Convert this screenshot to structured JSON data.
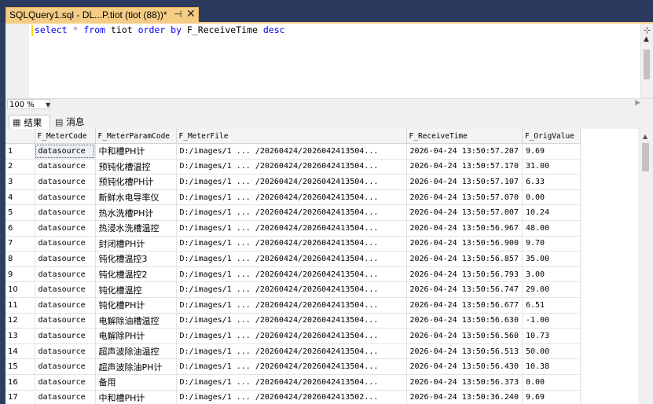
{
  "document_tab": {
    "title": "SQLQuery1.sql - DL...P.tiot (tiot (88))*"
  },
  "editor": {
    "query_tokens": [
      {
        "text": "select",
        "kind": "kw"
      },
      {
        "text": " ",
        "kind": "tx"
      },
      {
        "text": "*",
        "kind": "op"
      },
      {
        "text": " ",
        "kind": "tx"
      },
      {
        "text": "from",
        "kind": "kw"
      },
      {
        "text": " tiot ",
        "kind": "tx"
      },
      {
        "text": "order by",
        "kind": "kw"
      },
      {
        "text": " F_ReceiveTime ",
        "kind": "tx"
      },
      {
        "text": "desc",
        "kind": "kw"
      }
    ],
    "zoom": "100 %"
  },
  "results": {
    "tabs": [
      {
        "label": "结果",
        "icon": "grid-icon"
      },
      {
        "label": "消息",
        "icon": "messages-icon"
      }
    ],
    "columns": [
      "",
      "F_MeterCode",
      "F_MeterParamCode",
      "F_MeterFile",
      "F_ReceiveTime",
      "F_OrigValue"
    ],
    "rows": [
      [
        "1",
        "datasource",
        "中和槽PH计",
        "D:/images/1 ... /20260424/2026042413504...",
        "2026-04-24 13:50:57.207",
        "9.69"
      ],
      [
        "2",
        "datasource",
        "预钝化槽温控",
        "D:/images/1 ... /20260424/2026042413504...",
        "2026-04-24 13:50:57.170",
        "31.00"
      ],
      [
        "3",
        "datasource",
        "预钝化槽PH计",
        "D:/images/1 ... /20260424/2026042413504...",
        "2026-04-24 13:50:57.107",
        "6.33"
      ],
      [
        "4",
        "datasource",
        "新鲜水电导率仪",
        "D:/images/1 ... /20260424/2026042413504...",
        "2026-04-24 13:50:57.070",
        "0.00"
      ],
      [
        "5",
        "datasource",
        "热水洗槽PH计",
        "D:/images/1 ... /20260424/2026042413504...",
        "2026-04-24 13:50:57.007",
        "10.24"
      ],
      [
        "6",
        "datasource",
        "热浸水洗槽温控",
        "D:/images/1 ... /20260424/2026042413504...",
        "2026-04-24 13:50:56.967",
        "48.00"
      ],
      [
        "7",
        "datasource",
        "封闭槽PH计",
        "D:/images/1 ... /20260424/2026042413504...",
        "2026-04-24 13:50:56.900",
        "9.70"
      ],
      [
        "8",
        "datasource",
        "钝化槽温控3",
        "D:/images/1 ... /20260424/2026042413504...",
        "2026-04-24 13:50:56.857",
        "35.00"
      ],
      [
        "9",
        "datasource",
        "钝化槽温控2",
        "D:/images/1 ... /20260424/2026042413504...",
        "2026-04-24 13:50:56.793",
        "3.00"
      ],
      [
        "10",
        "datasource",
        "钝化槽温控",
        "D:/images/1 ... /20260424/2026042413504...",
        "2026-04-24 13:50:56.747",
        "29.00"
      ],
      [
        "11",
        "datasource",
        "钝化槽PH计",
        "D:/images/1 ... /20260424/2026042413504...",
        "2026-04-24 13:50:56.677",
        "6.51"
      ],
      [
        "12",
        "datasource",
        "电解除油槽温控",
        "D:/images/1 ... /20260424/2026042413504...",
        "2026-04-24 13:50:56.630",
        "-1.00"
      ],
      [
        "13",
        "datasource",
        "电解除PH计",
        "D:/images/1 ... /20260424/2026042413504...",
        "2026-04-24 13:50:56.560",
        "10.73"
      ],
      [
        "14",
        "datasource",
        "超声波除油温控",
        "D:/images/1 ... /20260424/2026042413504...",
        "2026-04-24 13:50:56.513",
        "50.00"
      ],
      [
        "15",
        "datasource",
        "超声波除油PH计",
        "D:/images/1 ... /20260424/2026042413504...",
        "2026-04-24 13:50:56.430",
        "10.38"
      ],
      [
        "16",
        "datasource",
        "备用",
        "D:/images/1 ... /20260424/2026042413504...",
        "2026-04-24 13:50:56.373",
        "0.00"
      ],
      [
        "17",
        "datasource",
        "中和槽PH计",
        "D:/images/1 ... /20260424/2026042413502...",
        "2026-04-24 13:50:36.240",
        "9.69"
      ]
    ]
  }
}
